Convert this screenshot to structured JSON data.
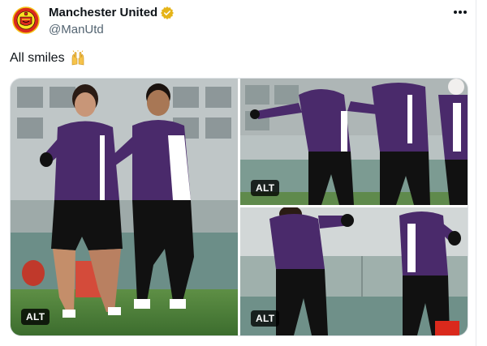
{
  "author": {
    "display_name": "Manchester United",
    "handle": "@ManUtd",
    "verified_color": "#e5b418"
  },
  "tweet": {
    "text": "All smiles",
    "emoji": "raised-hands"
  },
  "media": {
    "photos": [
      {
        "alt_badge": "ALT",
        "subject": "two-players-smiling"
      },
      {
        "alt_badge": "ALT",
        "subject": "players-training"
      },
      {
        "alt_badge": "ALT",
        "subject": "players-celebrating"
      }
    ]
  },
  "colors": {
    "text_primary": "#0f1419",
    "text_secondary": "#536471",
    "kit_purple": "#4a2a6b",
    "grass": "#3f7d3a",
    "club_red": "#da291c"
  },
  "icons": {
    "more": "more-horizontal-icon",
    "verified": "verified-badge-icon"
  }
}
